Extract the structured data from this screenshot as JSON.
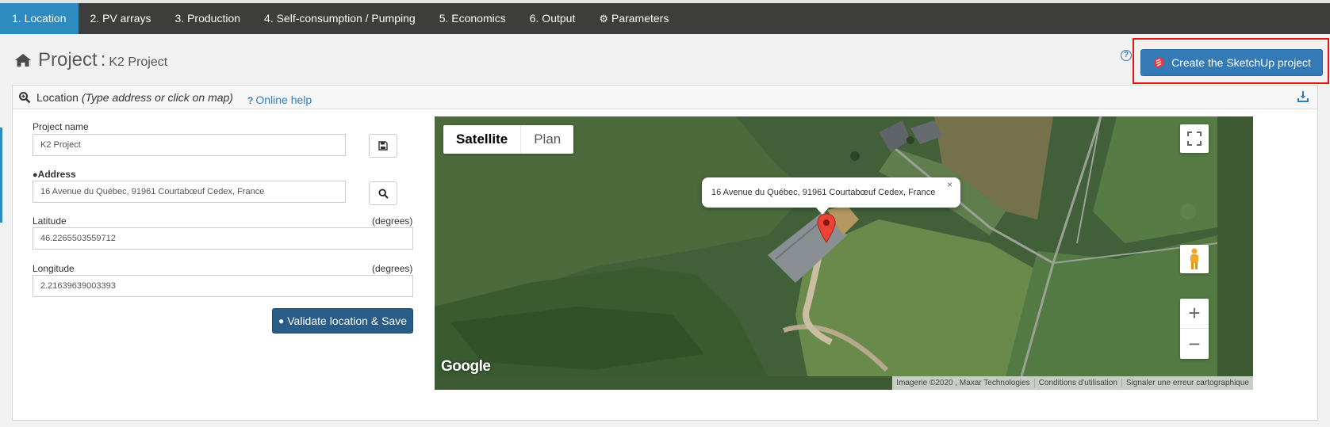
{
  "nav": {
    "tabs": [
      {
        "label": "1. Location"
      },
      {
        "label": "2. PV arrays"
      },
      {
        "label": "3. Production"
      },
      {
        "label": "4. Self-consumption / Pumping"
      },
      {
        "label": "5. Economics"
      },
      {
        "label": "6. Output"
      },
      {
        "label": "Parameters",
        "icon": "gears-icon"
      }
    ],
    "active_index": 0,
    "active_color": "#2f8ac0"
  },
  "header": {
    "project_word": "Project",
    "colon": ":",
    "project_name": "K2 Project",
    "help_glyph": "?",
    "sketchup_button": "Create the SketchUp project"
  },
  "location_panel": {
    "title": "Location",
    "title_hint": "(Type address or click on map)",
    "online_help": "Online help",
    "form": {
      "project_name_label": "Project name",
      "project_name_value": "K2 Project",
      "address_label": "Address",
      "address_value": "16 Avenue du Québec, 91961 Courtabœuf Cedex, France",
      "latitude_label": "Latitude",
      "latitude_unit": "(degrees)",
      "latitude_value": "46.2265503559712",
      "longitude_label": "Longitude",
      "longitude_unit": "(degrees)",
      "longitude_value": "2.21639639003393",
      "validate_button": "Validate location & Save"
    },
    "map": {
      "type_satellite": "Satellite",
      "type_plan": "Plan",
      "selected_type": "Satellite",
      "infowindow_text": "16 Avenue du Québec, 91961 Courtabœuf Cedex, France",
      "close_glyph": "×",
      "zoom_in": "+",
      "zoom_out": "−",
      "logo": "Google",
      "attribution": [
        "Imagerie ©2020 , Maxar Technologies",
        "Conditions d'utilisation",
        "Signaler une erreur cartographique"
      ]
    }
  }
}
